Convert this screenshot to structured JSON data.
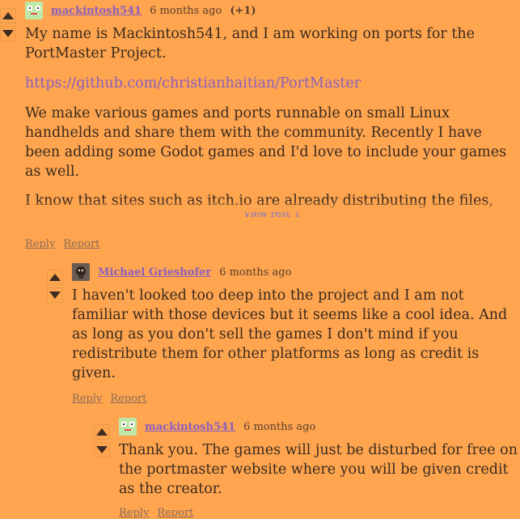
{
  "comments": [
    {
      "username": "mackintosh541",
      "time": "6 months ago",
      "score": "(+1)",
      "body": [
        "My name is Mackintosh541, and I am working on ports for the PortMaster Project.",
        "https://github.com/christianhaitian/PortMaster",
        "We make various games and ports runnable on small Linux handhelds and share them with the community. Recently I have been adding some Godot games and I'd love to include your games as well.",
        "I know that sites such as itch.io are already distributing the files,"
      ],
      "view_rest": "View rest ↓",
      "reply": "Reply",
      "report": "Report",
      "avatar": "frog-avatar"
    },
    {
      "username": "Michael Grieshofer",
      "time": "6 months ago",
      "body": "I haven't looked too deep into the project and I am not familiar with those devices but it seems like a cool idea. And as long as you don't sell the games I don't mind if you redistribute them for other platforms as long as credit is given.",
      "reply": "Reply",
      "report": "Report",
      "avatar": "character-avatar"
    },
    {
      "username": "mackintosh541",
      "time": "6 months ago",
      "body": "Thank you. The games will just be disturbed for free on the portmaster website where you will be given credit as the creator.",
      "reply": "Reply",
      "report": "Report",
      "avatar": "frog-avatar"
    }
  ],
  "colors": {
    "background": "#ffa54f",
    "text": "#3a2a1f",
    "link": "#8b5fbf",
    "muted": "#8c6b58"
  }
}
